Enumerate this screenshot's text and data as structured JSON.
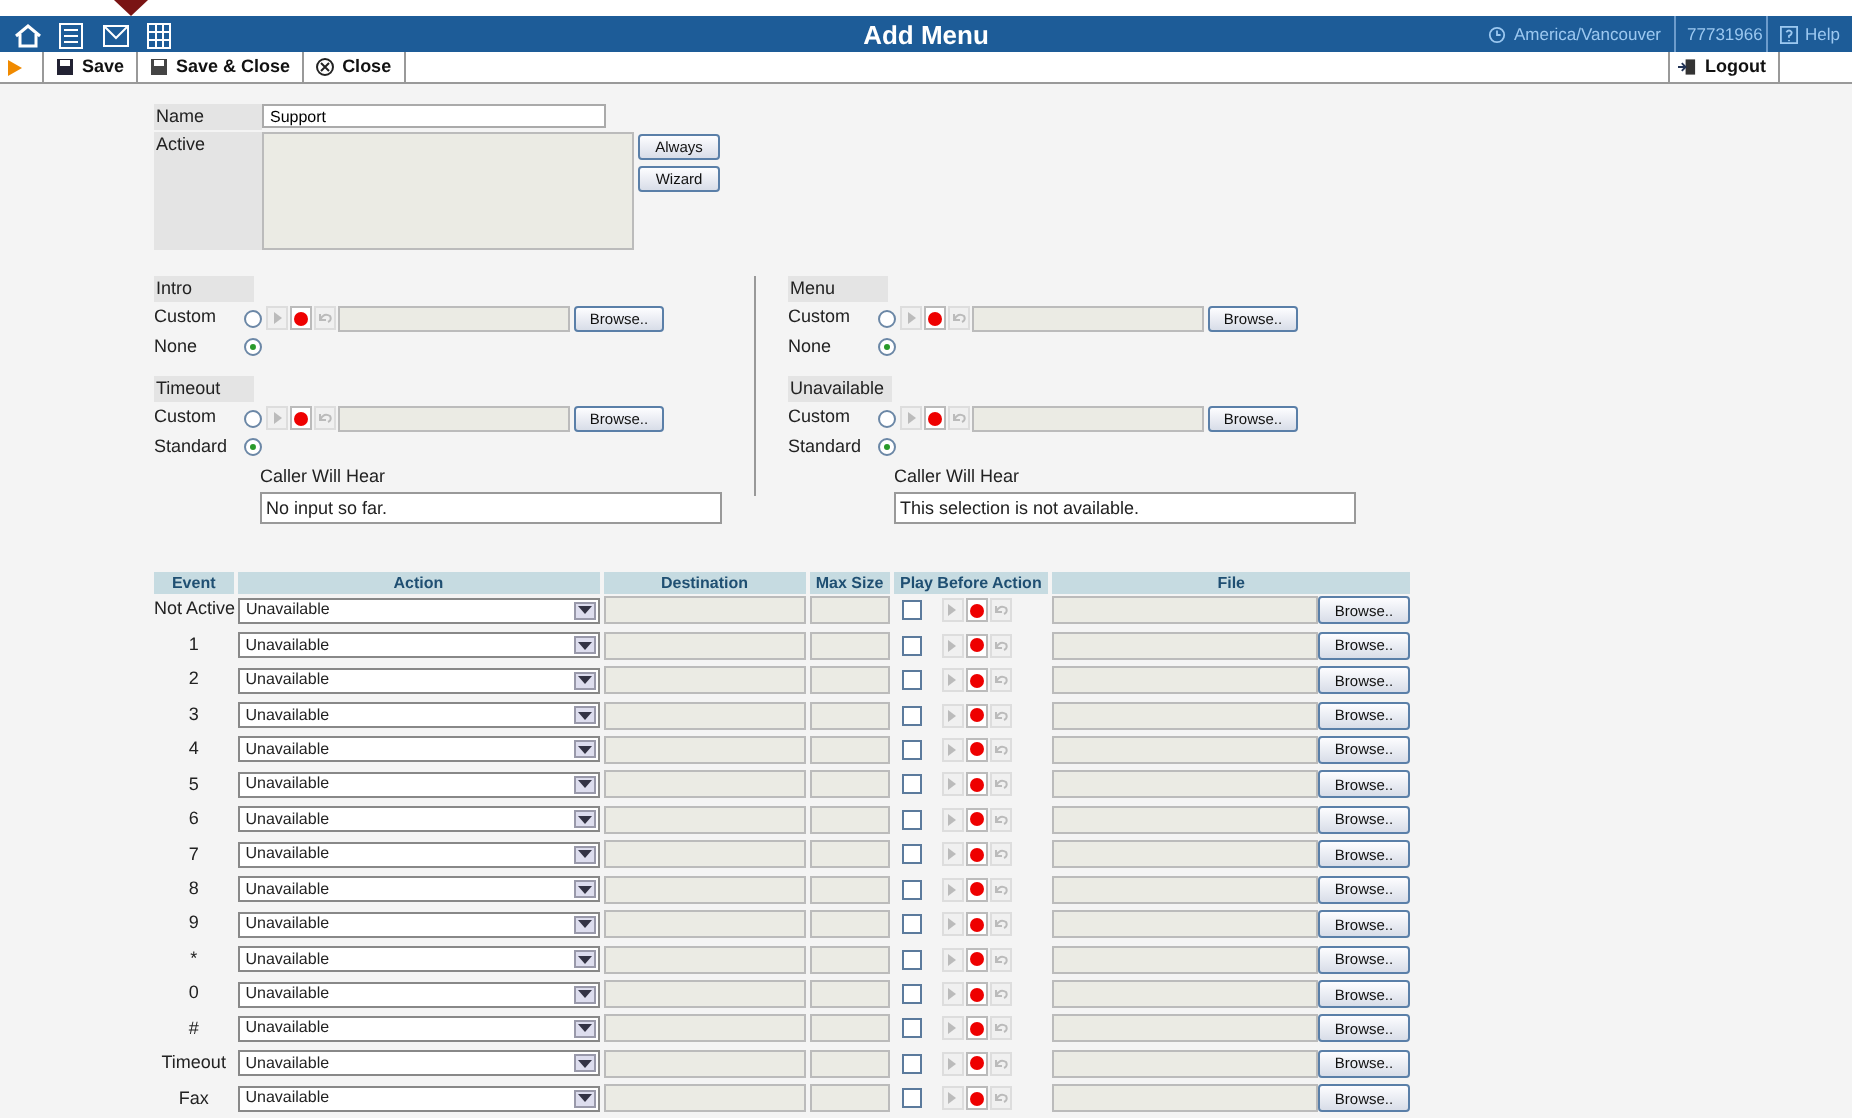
{
  "app_bar": {
    "title": "Add Menu",
    "timezone": "America/Vancouver",
    "account": "77731966",
    "help": "Help"
  },
  "toolbar": {
    "buttons": [
      "Save",
      "Save & Close",
      "Close"
    ],
    "logout": "Logout"
  },
  "form": {
    "name_label": "Name",
    "name_value": "Support",
    "active_label": "Active",
    "active_buttons": [
      "Always",
      "Wizard"
    ]
  },
  "prompt_columns": [
    [
      {
        "title": "Intro",
        "options": [
          {
            "label": "Custom",
            "selected": false
          },
          {
            "label": "None",
            "selected": true
          }
        ],
        "browse": "Browse.."
      },
      {
        "title": "Timeout",
        "options": [
          {
            "label": "Custom",
            "selected": false
          },
          {
            "label": "Standard",
            "selected": true
          }
        ],
        "browse": "Browse..",
        "caller_hears_label": "Caller Will Hear",
        "caller_hears": "No input so far."
      }
    ],
    [
      {
        "title": "Menu",
        "options": [
          {
            "label": "Custom",
            "selected": false
          },
          {
            "label": "None",
            "selected": true
          }
        ],
        "browse": "Browse.."
      },
      {
        "title": "Unavailable",
        "options": [
          {
            "label": "Custom",
            "selected": false
          },
          {
            "label": "Standard",
            "selected": true
          }
        ],
        "browse": "Browse..",
        "caller_hears_label": "Caller Will Hear",
        "caller_hears": "This selection is not available."
      }
    ]
  ],
  "table": {
    "columns": [
      "Event",
      "Action",
      "Destination",
      "Max Size",
      "Play Before Action",
      "File"
    ],
    "rows": [
      {
        "event": "Not Active",
        "action": "Unavailable",
        "play_before": false,
        "browse": "Browse.."
      },
      {
        "event": "1",
        "action": "Unavailable",
        "play_before": false,
        "browse": "Browse.."
      },
      {
        "event": "2",
        "action": "Unavailable",
        "play_before": false,
        "browse": "Browse.."
      },
      {
        "event": "3",
        "action": "Unavailable",
        "play_before": false,
        "browse": "Browse.."
      },
      {
        "event": "4",
        "action": "Unavailable",
        "play_before": false,
        "browse": "Browse.."
      },
      {
        "event": "5",
        "action": "Unavailable",
        "play_before": false,
        "browse": "Browse.."
      },
      {
        "event": "6",
        "action": "Unavailable",
        "play_before": false,
        "browse": "Browse.."
      },
      {
        "event": "7",
        "action": "Unavailable",
        "play_before": false,
        "browse": "Browse.."
      },
      {
        "event": "8",
        "action": "Unavailable",
        "play_before": false,
        "browse": "Browse.."
      },
      {
        "event": "9",
        "action": "Unavailable",
        "play_before": false,
        "browse": "Browse.."
      },
      {
        "event": "*",
        "action": "Unavailable",
        "play_before": false,
        "browse": "Browse.."
      },
      {
        "event": "0",
        "action": "Unavailable",
        "play_before": false,
        "browse": "Browse.."
      },
      {
        "event": "#",
        "action": "Unavailable",
        "play_before": false,
        "browse": "Browse.."
      },
      {
        "event": "Timeout",
        "action": "Unavailable",
        "play_before": false,
        "browse": "Browse.."
      },
      {
        "event": "Fax",
        "action": "Unavailable",
        "play_before": false,
        "browse": "Browse.."
      }
    ]
  }
}
